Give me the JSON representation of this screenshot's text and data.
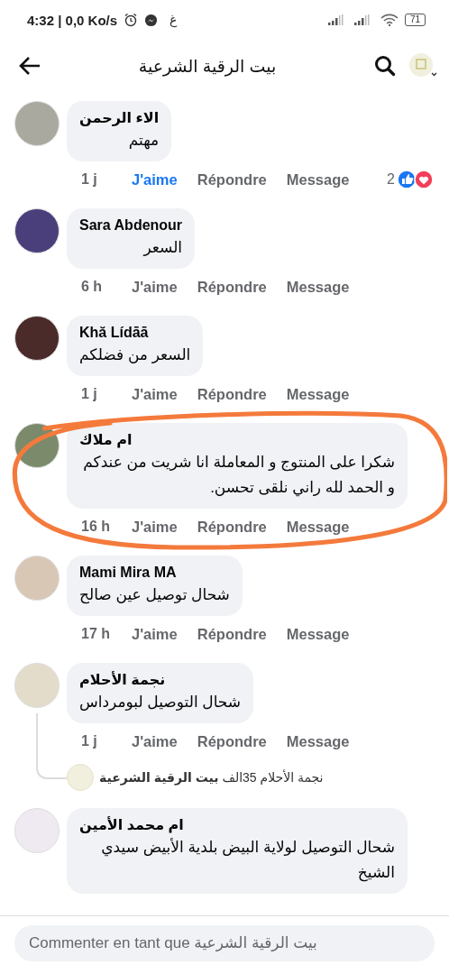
{
  "status_bar": {
    "time": "4:32 | 0,0 Ko/s",
    "letter": "غ",
    "battery": "71"
  },
  "header": {
    "title": "بيت الرقية الشرعية"
  },
  "comments": [
    {
      "author": "الاء الرحمن",
      "text": "مهتم",
      "time": "1 j",
      "like": "J'aime",
      "liked": true,
      "reply": "Répondre",
      "message": "Message",
      "reaction_count": "2",
      "circled": false
    },
    {
      "author": "Sara Abdenour",
      "text": "السعر",
      "time": "6 h",
      "like": "J'aime",
      "liked": false,
      "reply": "Répondre",
      "message": "Message",
      "circled": false
    },
    {
      "author": "Khă Lídāā",
      "text": "السعر من فضلكم",
      "time": "1 j",
      "like": "J'aime",
      "liked": false,
      "reply": "Répondre",
      "message": "Message",
      "circled": false
    },
    {
      "author": "ام ملاك",
      "text": "شكرا على المنتوج و المعاملة انا شريت من عندكم و الحمد لله راني نلقى تحسن.",
      "time": "16 h",
      "like": "J'aime",
      "liked": false,
      "reply": "Répondre",
      "message": "Message",
      "circled": true
    },
    {
      "author": "Mami Mira MA",
      "text": "شحال توصيل عين صالح",
      "time": "17 h",
      "like": "J'aime",
      "liked": false,
      "reply": "Répondre",
      "message": "Message",
      "circled": false
    },
    {
      "author": "نجمة الأحلام",
      "text": "شحال التوصيل لبومرداس",
      "time": "1 j",
      "like": "J'aime",
      "liked": false,
      "reply": "Répondre",
      "message": "Message",
      "circled": false,
      "replies_summary": "نجمة الأحلام 35الف **بيت الرقية الشرعية**"
    },
    {
      "author": "ام محمد الأمين",
      "text": "شحال التوصيل لولاية البيض بلدية الأبيض سيدي الشيخ",
      "circled": false
    }
  ],
  "composer": {
    "placeholder": "Commenter en tant que بيت الرقية الشرعية"
  }
}
